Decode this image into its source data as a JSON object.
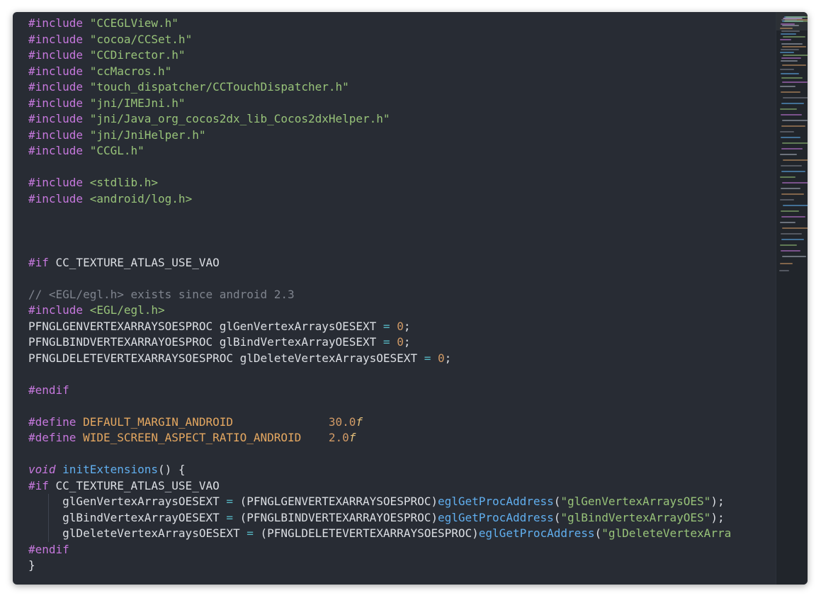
{
  "editor": {
    "lines": [
      [
        {
          "t": "#include ",
          "c": "kw"
        },
        {
          "t": "\"CCEGLView.h\"",
          "c": "str"
        }
      ],
      [
        {
          "t": "#include ",
          "c": "kw"
        },
        {
          "t": "\"cocoa/CCSet.h\"",
          "c": "str"
        }
      ],
      [
        {
          "t": "#include ",
          "c": "kw"
        },
        {
          "t": "\"CCDirector.h\"",
          "c": "str"
        }
      ],
      [
        {
          "t": "#include ",
          "c": "kw"
        },
        {
          "t": "\"ccMacros.h\"",
          "c": "str"
        }
      ],
      [
        {
          "t": "#include ",
          "c": "kw"
        },
        {
          "t": "\"touch_dispatcher/CCTouchDispatcher.h\"",
          "c": "str"
        }
      ],
      [
        {
          "t": "#include ",
          "c": "kw"
        },
        {
          "t": "\"jni/IMEJni.h\"",
          "c": "str"
        }
      ],
      [
        {
          "t": "#include ",
          "c": "kw"
        },
        {
          "t": "\"jni/Java_org_cocos2dx_lib_Cocos2dxHelper.h\"",
          "c": "str"
        }
      ],
      [
        {
          "t": "#include ",
          "c": "kw"
        },
        {
          "t": "\"jni/JniHelper.h\"",
          "c": "str"
        }
      ],
      [
        {
          "t": "#include ",
          "c": "kw"
        },
        {
          "t": "\"CCGL.h\"",
          "c": "str"
        }
      ],
      [],
      [
        {
          "t": "#include ",
          "c": "kw"
        },
        {
          "t": "<stdlib.h>",
          "c": "str"
        }
      ],
      [
        {
          "t": "#include ",
          "c": "kw"
        },
        {
          "t": "<android/log.h>",
          "c": "str"
        }
      ],
      [],
      [],
      [],
      [
        {
          "t": "#if ",
          "c": "kw"
        },
        {
          "t": "CC_TEXTURE_ATLAS_USE_VAO",
          "c": ""
        }
      ],
      [],
      [
        {
          "t": "// <EGL/egl.h> exists since android 2.3",
          "c": "cmt"
        }
      ],
      [
        {
          "t": "#include ",
          "c": "kw"
        },
        {
          "t": "<EGL/egl.h>",
          "c": "str"
        }
      ],
      [
        {
          "t": "PFNGLGENVERTEXARRAYSOESPROC glGenVertexArraysOESEXT ",
          "c": ""
        },
        {
          "t": "=",
          "c": "op"
        },
        {
          "t": " ",
          "c": ""
        },
        {
          "t": "0",
          "c": "num"
        },
        {
          "t": ";",
          "c": ""
        }
      ],
      [
        {
          "t": "PFNGLBINDVERTEXARRAYOESPROC glBindVertexArrayOESEXT ",
          "c": ""
        },
        {
          "t": "=",
          "c": "op"
        },
        {
          "t": " ",
          "c": ""
        },
        {
          "t": "0",
          "c": "num"
        },
        {
          "t": ";",
          "c": ""
        }
      ],
      [
        {
          "t": "PFNGLDELETEVERTEXARRAYSOESPROC glDeleteVertexArraysOESEXT ",
          "c": ""
        },
        {
          "t": "=",
          "c": "op"
        },
        {
          "t": " ",
          "c": ""
        },
        {
          "t": "0",
          "c": "num"
        },
        {
          "t": ";",
          "c": ""
        }
      ],
      [],
      [
        {
          "t": "#endif",
          "c": "kw"
        }
      ],
      [],
      [
        {
          "t": "#define ",
          "c": "kw"
        },
        {
          "t": "DEFAULT_MARGIN_ANDROID",
          "c": "macro"
        },
        {
          "t": "              ",
          "c": ""
        },
        {
          "t": "30.0",
          "c": "num"
        },
        {
          "t": "f",
          "c": "f"
        }
      ],
      [
        {
          "t": "#define ",
          "c": "kw"
        },
        {
          "t": "WIDE_SCREEN_ASPECT_RATIO_ANDROID",
          "c": "macro"
        },
        {
          "t": "    ",
          "c": ""
        },
        {
          "t": "2.0",
          "c": "num"
        },
        {
          "t": "f",
          "c": "f"
        }
      ],
      [],
      [
        {
          "t": "void",
          "c": "kw italic"
        },
        {
          "t": " ",
          "c": ""
        },
        {
          "t": "initExtensions",
          "c": "fn"
        },
        {
          "t": "() {",
          "c": ""
        }
      ],
      [
        {
          "t": "#if ",
          "c": "kw"
        },
        {
          "t": "CC_TEXTURE_ATLAS_USE_VAO",
          "c": ""
        }
      ],
      [
        {
          "t": "     glGenVertexArraysOESEXT ",
          "c": ""
        },
        {
          "t": "=",
          "c": "op"
        },
        {
          "t": " (PFNGLGENVERTEXARRAYSOESPROC)",
          "c": ""
        },
        {
          "t": "eglGetProcAddress",
          "c": "fn"
        },
        {
          "t": "(",
          "c": ""
        },
        {
          "t": "\"glGenVertexArraysOES\"",
          "c": "str"
        },
        {
          "t": ");",
          "c": ""
        }
      ],
      [
        {
          "t": "     glBindVertexArrayOESEXT ",
          "c": ""
        },
        {
          "t": "=",
          "c": "op"
        },
        {
          "t": " (PFNGLBINDVERTEXARRAYOESPROC)",
          "c": ""
        },
        {
          "t": "eglGetProcAddress",
          "c": "fn"
        },
        {
          "t": "(",
          "c": ""
        },
        {
          "t": "\"glBindVertexArrayOES\"",
          "c": "str"
        },
        {
          "t": ");",
          "c": ""
        }
      ],
      [
        {
          "t": "     glDeleteVertexArraysOESEXT ",
          "c": ""
        },
        {
          "t": "=",
          "c": "op"
        },
        {
          "t": " (PFNGLDELETEVERTEXARRAYSOESPROC)",
          "c": ""
        },
        {
          "t": "eglGetProcAddress",
          "c": "fn"
        },
        {
          "t": "(",
          "c": ""
        },
        {
          "t": "\"glDeleteVertexArra",
          "c": "str"
        }
      ],
      [
        {
          "t": "#endif",
          "c": "kw"
        }
      ],
      [
        {
          "t": "}",
          "c": ""
        }
      ]
    ]
  },
  "theme": {
    "background": "#282c34",
    "minimap_background": "#21252b",
    "keyword": "#c678dd",
    "string": "#98c379",
    "number": "#d19a66",
    "function": "#61afef",
    "comment": "#7f848e"
  }
}
